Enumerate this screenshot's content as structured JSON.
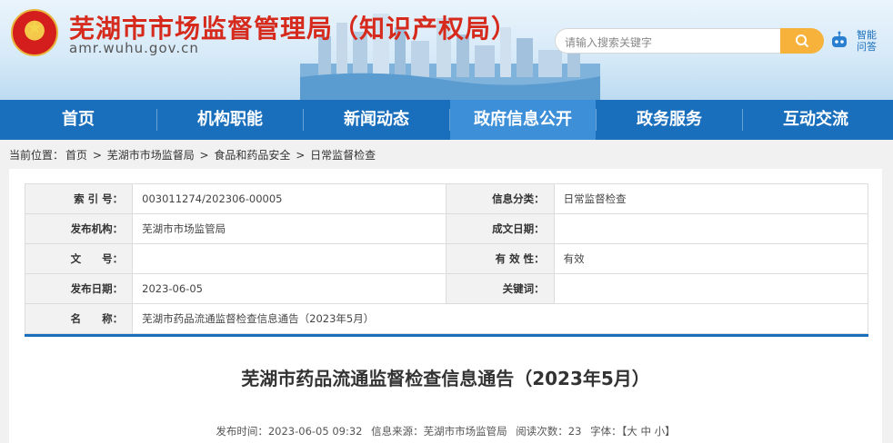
{
  "header": {
    "title": "芜湖市市场监督管理局（知识产权局）",
    "domain": "amr.wuhu.gov.cn",
    "search_placeholder": "请输入搜索关键字",
    "robot_label": "智能问答"
  },
  "nav": {
    "items": [
      "首页",
      "机构职能",
      "新闻动态",
      "政府信息公开",
      "政务服务",
      "互动交流"
    ],
    "active_index": 3
  },
  "breadcrumb": {
    "prefix": "当前位置：",
    "items": [
      "首页",
      "芜湖市市场监督局",
      "食品和药品安全",
      "日常监督检查"
    ],
    "separator": " > "
  },
  "meta": {
    "index_label": "索 引 号：",
    "index_value": "003011274/202306-00005",
    "category_label": "信息分类：",
    "category_value": "日常监督检查",
    "publisher_label": "发布机构：",
    "publisher_value": "芜湖市市场监管局",
    "created_label": "成文日期：",
    "created_value": "",
    "docno_label": "文　　号：",
    "docno_value": "",
    "validity_label": "有 效 性：",
    "validity_value": "有效",
    "pubdate_label": "发布日期：",
    "pubdate_value": "2023-06-05",
    "keywords_label": "关键词：",
    "keywords_value": "",
    "name_label": "名　　称：",
    "name_value": "芜湖市药品流通监督检查信息通告（2023年5月）"
  },
  "article": {
    "title": "芜湖市药品流通监督检查信息通告（2023年5月）",
    "pub_time": "发布时间：2023-06-05 09:32",
    "source": "信息来源：芜湖市市场监管局",
    "views": "阅读次数：23",
    "font_size": "字体：【大 中 小】"
  },
  "colors": {
    "primary": "#1a6fbd",
    "title_red": "#d52a1c",
    "search_orange": "#f6b23a"
  }
}
